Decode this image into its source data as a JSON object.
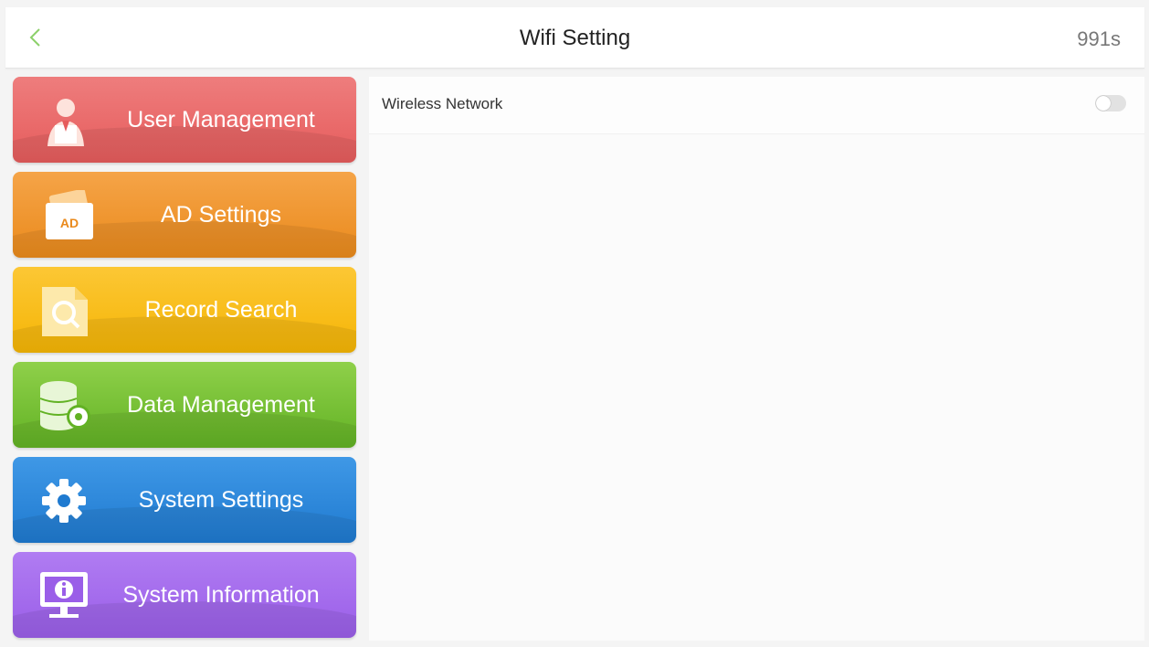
{
  "header": {
    "back_icon": "chevron-left-icon",
    "title": "Wifi Setting",
    "timer": "991s",
    "accent_color": "#8cd06a"
  },
  "sidebar": {
    "items": [
      {
        "label": "User Management",
        "icon": "user-icon",
        "color": "#ea6b6b"
      },
      {
        "label": "AD Settings",
        "icon": "ad-card-icon",
        "icon_text": "AD",
        "color": "#f09a35"
      },
      {
        "label": "Record Search",
        "icon": "document-search-icon",
        "color": "#fbbf1e"
      },
      {
        "label": "Data Management",
        "icon": "database-gear-icon",
        "color": "#74c033"
      },
      {
        "label": "System Settings",
        "icon": "gear-icon",
        "color": "#2c88da"
      },
      {
        "label": "System Information",
        "icon": "monitor-info-icon",
        "color": "#a46cee"
      }
    ]
  },
  "main": {
    "wireless_network": {
      "label": "Wireless Network",
      "enabled": false
    }
  }
}
